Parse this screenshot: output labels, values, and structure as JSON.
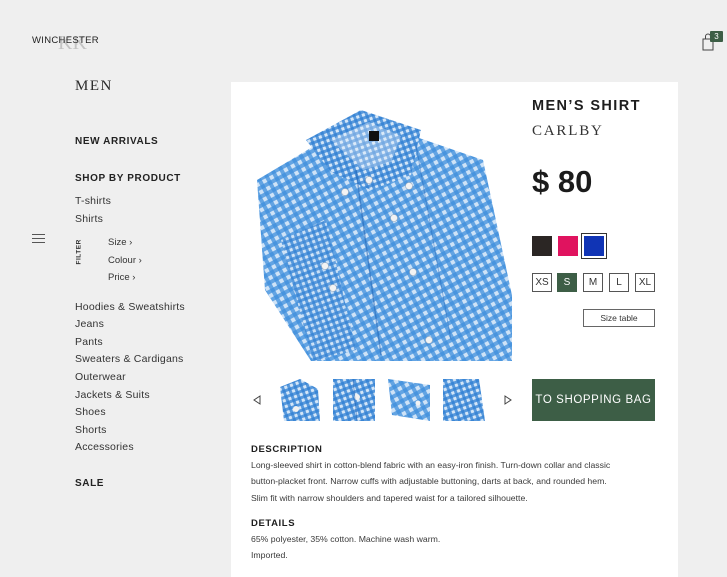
{
  "header": {
    "brand": "WINCHESTER",
    "bag_count": "3"
  },
  "sidebar": {
    "title": "MEN",
    "new_arrivals": "NEW ARRIVALS",
    "shop_by_product": "SHOP BY PRODUCT",
    "filter_label": "FILTER",
    "top_links": [
      "T-shirts",
      "Shirts"
    ],
    "filters": [
      "Size ›",
      "Colour ›",
      "Price ›"
    ],
    "links": [
      "Hoodies & Sweatshirts",
      "Jeans",
      "Pants",
      "Sweaters & Cardigans",
      "Outerwear",
      "Jackets & Suits",
      "Shoes",
      "Shorts",
      "Accessories"
    ],
    "sale": "SALE"
  },
  "product": {
    "name": "MEN’S SHIRT",
    "brand": "CARLBY",
    "price": "$ 80",
    "colors": [
      "#2b2624",
      "#e0135f",
      "#1034b5"
    ],
    "selected_color_index": 2,
    "sizes": [
      "XS",
      "S",
      "M",
      "L",
      "XL"
    ],
    "selected_size": "S",
    "size_table": "Size table",
    "add_to_bag": "TO SHOPPING BAG",
    "description_title": "DESCRIPTION",
    "description_lines": [
      "Long-sleeved shirt in cotton-blend fabric with an easy-iron finish. Turn-down collar and classic",
      "button-placket front. Narrow cuffs with adjustable buttoning, darts at back, and rounded hem.",
      "Slim fit with narrow shoulders and tapered waist for a tailored silhouette."
    ],
    "details_title": "DETAILS",
    "details_lines": [
      "65% polyester, 35% cotton. Machine wash warm.",
      "Imported."
    ]
  }
}
